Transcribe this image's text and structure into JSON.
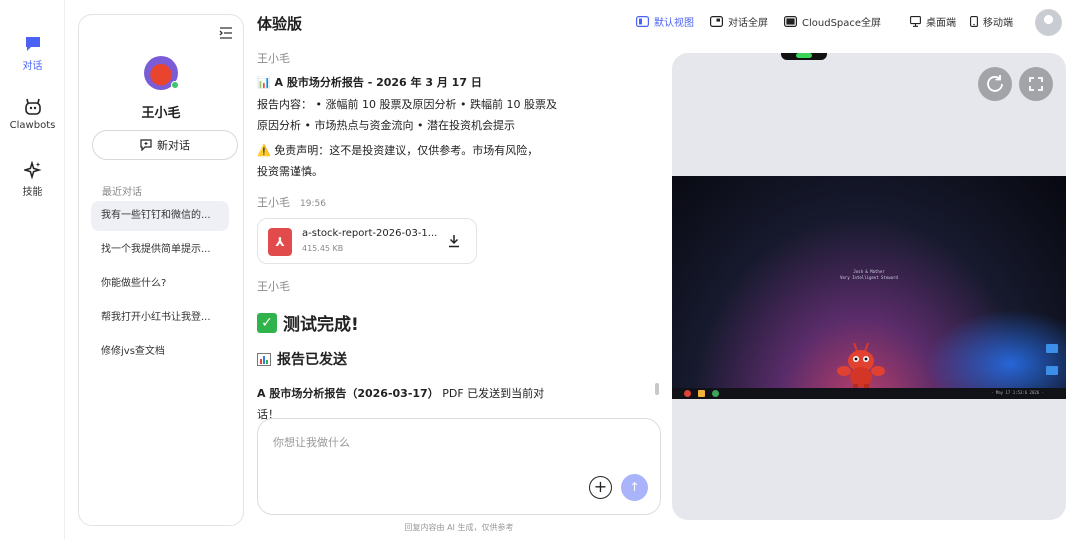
{
  "rail": {
    "items": [
      {
        "label": "对话",
        "icon": "chat-icon",
        "active": true
      },
      {
        "label": "Clawbots",
        "icon": "bot-icon",
        "active": false
      },
      {
        "label": "技能",
        "icon": "sparkle-icon",
        "active": false
      }
    ]
  },
  "sidebar": {
    "user_name": "王小毛",
    "new_chat_label": "新对话",
    "recent_title": "最近对话",
    "history": [
      "我有一些钉钉和微信的...",
      "找一个我提供简单提示...",
      "你能做些什么?",
      "帮我打开小红书让我登...",
      "修修jvs查文档"
    ]
  },
  "header": {
    "title": "体验版",
    "nav": [
      {
        "label": "默认视图",
        "icon": "default-view-icon",
        "active": true
      },
      {
        "label": "对话全屏",
        "icon": "chat-fullscreen-icon",
        "active": false
      },
      {
        "label": "CloudSpace全屏",
        "icon": "cloudspace-fullscreen-icon",
        "active": false
      },
      {
        "label": "桌面端",
        "icon": "desktop-icon",
        "active": false
      },
      {
        "label": "移动端",
        "icon": "mobile-icon",
        "active": false
      }
    ]
  },
  "chat": {
    "msg1": {
      "sender": "王小毛",
      "title": "📊 A 股市场分析报告 - 2026 年 3 月 17 日",
      "content_line1": "报告内容： • 涨幅前 10 股票及原因分析 • 跌幅前 10 股票及",
      "content_line2": "原因分析 • 市场热点与资金流向 • 潜在投资机会提示",
      "disclaimer_line1": "⚠️ 免责声明：这不是投资建议，仅供参考。市场有风险，",
      "disclaimer_line2": "投资需谨慎。"
    },
    "msg2": {
      "sender": "王小毛",
      "time": "19:56",
      "file_name": "a-stock-report-2026-03-1...",
      "file_size": "415.45 KB"
    },
    "msg3": {
      "sender": "王小毛",
      "big_title": "测试完成!",
      "sub_title": "报告已发送",
      "final_bold": "A 股市场分析报告（2026-03-17）",
      "final_rest": " PDF 已发送到当前对",
      "final_line2": "话！"
    }
  },
  "composer": {
    "placeholder": "你想让我做什么",
    "footer": "回复内容由 AI 生成，仅供参考"
  },
  "device": {
    "screen_line1": "Josh & Mather",
    "screen_line2": "Very Intelligent Steward",
    "taskbar_text": "· May 17 1:53:6 2026 ·",
    "colors": {
      "notch_led": "#3cd35a",
      "accent": "#4a63f5"
    }
  }
}
